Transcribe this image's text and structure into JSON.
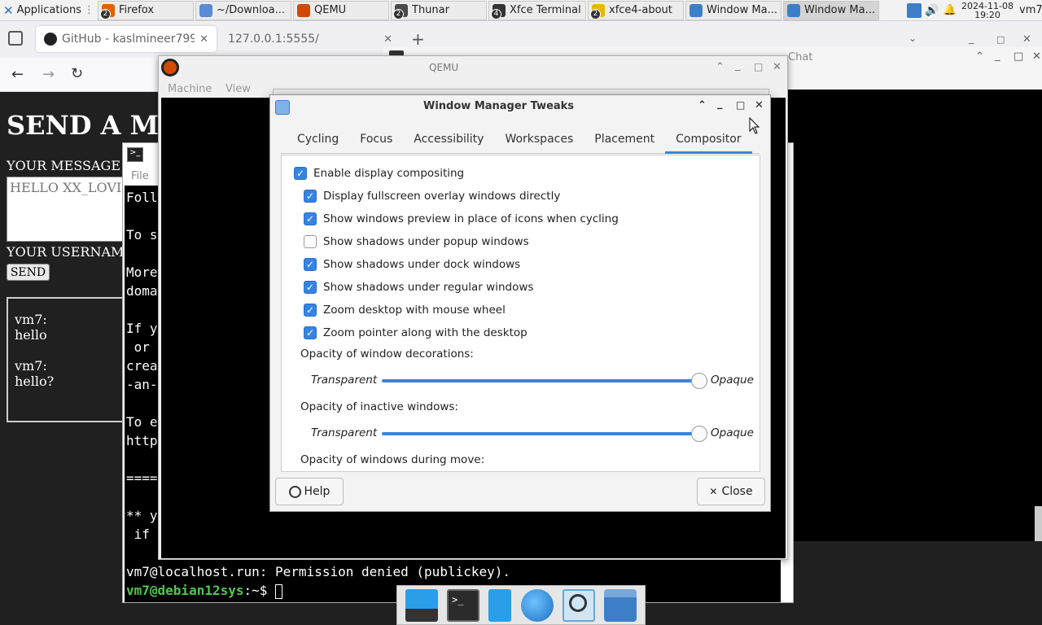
{
  "panel": {
    "applications": "Applications",
    "tasks": [
      {
        "label": "Firefox",
        "count": "2",
        "color": "#e66000"
      },
      {
        "label": "~/Downloa...",
        "count": "",
        "color": "#5b8bd8"
      },
      {
        "label": "QEMU",
        "count": "",
        "color": "#d24a00"
      },
      {
        "label": "Thunar",
        "count": "2",
        "color": "#4a4a4a"
      },
      {
        "label": "Xfce Terminal",
        "count": "4",
        "color": "#333333"
      },
      {
        "label": "xfce4-about",
        "count": "2",
        "color": "#e6b800"
      },
      {
        "label": "Window Ma...",
        "count": "",
        "color": "#3c7fc8"
      },
      {
        "label": "Window Ma...",
        "count": "",
        "color": "#3c7fc8"
      }
    ],
    "date": "2024-11-08",
    "time": "19:20",
    "user": "vm7"
  },
  "firefox": {
    "tab1": "GitHub - kaslmineer799",
    "tab2": "127.0.0.1:5555/",
    "heading": "SEND A M",
    "message_label": "YOUR MESSAGE",
    "message_value": "HELLO XX_LOVI",
    "username_label": "YOUR USERNAM",
    "send": "SEND",
    "chat": [
      "vm7:",
      "hello",
      "vm7:",
      "hello?"
    ]
  },
  "right_window": {
    "title": "Chat"
  },
  "terminal": {
    "menu_file": "File",
    "lines": [
      "Foll",
      "To s",
      "More",
      "doma",
      "If y",
      " or",
      "crea",
      "-an-",
      "To e",
      "http",
      "====",
      "** y",
      " if"
    ],
    "permission": "vm7@localhost.run: Permission denied (publickey).",
    "prompt_user": "vm7@debian12sys",
    "prompt_rest": ":~$"
  },
  "qemu": {
    "title": "QEMU",
    "menu": [
      "Machine",
      "View"
    ]
  },
  "tweaks": {
    "title": "Window Manager Tweaks",
    "tabs": [
      "Cycling",
      "Focus",
      "Accessibility",
      "Workspaces",
      "Placement",
      "Compositor"
    ],
    "selected_tab": "Compositor",
    "enable": {
      "label": "Enable display compositing",
      "checked": true
    },
    "options": [
      {
        "label": "Display fullscreen overlay windows directly",
        "checked": true
      },
      {
        "label": "Show windows preview in place of icons when cycling",
        "checked": true
      },
      {
        "label": "Show shadows under popup windows",
        "checked": false
      },
      {
        "label": "Show shadows under dock windows",
        "checked": true
      },
      {
        "label": "Show shadows under regular windows",
        "checked": true
      },
      {
        "label": "Zoom desktop with mouse wheel",
        "checked": true
      },
      {
        "label": "Zoom pointer along with the desktop",
        "checked": true
      }
    ],
    "opacity_decorations": "Opacity of window decorations:",
    "opacity_inactive": "Opacity of inactive windows:",
    "opacity_move": "Opacity of windows during move:",
    "transparent": "Transparent",
    "opaque": "Opaque",
    "opacity_decorations_value": 1.0,
    "opacity_inactive_value": 1.0,
    "help": "Help",
    "close": "Close"
  },
  "colors": {
    "accent": "#3584e4",
    "prompt_green": "#4ec94e"
  }
}
